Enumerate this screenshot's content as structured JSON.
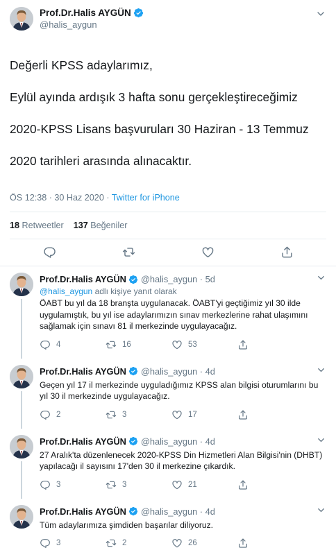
{
  "tweet": {
    "author_name": "Prof.Dr.Halis AYGÜN",
    "author_handle": "@halis_aygun",
    "lines": [
      "Değerli KPSS adaylarımız,",
      "Eylül ayında ardışık 3 hafta sonu gerçekleştireceğimiz",
      "2020-KPSS Lisans başvuruları 30 Haziran - 13 Temmuz",
      "2020 tarihleri arasında alınacaktır."
    ],
    "time": "ÖS 12:38 · 30 Haz 2020",
    "dot": " · ",
    "source": "Twitter for iPhone",
    "retweets_count": "18",
    "retweets_label": "Retweetler",
    "likes_count": "137",
    "likes_label": "Beğeniler"
  },
  "replies": [
    {
      "name": "Prof.Dr.Halis AYGÜN",
      "meta": "@halis_aygun · 5d",
      "replying_mention": "@halis_aygun",
      "replying_suffix": " adlı kişiye yanıt olarak",
      "text": "ÖABT bu yıl da 18 branşta uygulanacak. ÖABT'yi geçtiğimiz yıl 30 ilde uygulamıştık, bu yıl ise adaylarımızın sınav merkezlerine rahat ulaşımını sağlamak için sınavı 81 il merkezinde uygulayacağız.",
      "replies": "4",
      "retweets": "16",
      "likes": "53"
    },
    {
      "name": "Prof.Dr.Halis AYGÜN",
      "meta": "@halis_aygun · 4d",
      "text": "Geçen yıl 17 il merkezinde uyguladığımız KPSS alan bilgisi oturumlarını bu yıl 30 il merkezinde uygulayacağız.",
      "replies": "2",
      "retweets": "3",
      "likes": "17"
    },
    {
      "name": "Prof.Dr.Halis AYGÜN",
      "meta": "@halis_aygun · 4d",
      "text": "27 Aralık'ta düzenlenecek 2020-KPSS Din Hizmetleri Alan Bilgisi'nin (DHBT) yapılacağı il sayısını 17'den 30 il merkezine çıkardık.",
      "replies": "3",
      "retweets": "3",
      "likes": "21"
    },
    {
      "name": "Prof.Dr.Halis AYGÜN",
      "meta": "@halis_aygun · 4d",
      "text": "Tüm adaylarımıza şimdiden başarılar diliyoruz.",
      "replies": "3",
      "retweets": "2",
      "likes": "26"
    }
  ],
  "colors": {
    "link": "#1b95e0",
    "secondary_text": "#657786",
    "verified": "#1da1f2",
    "divider": "#e6ecf0"
  },
  "icons": {
    "verified": "verified-badge-icon",
    "caret": "chevron-down-icon",
    "reply": "reply-icon",
    "retweet": "retweet-icon",
    "like": "heart-icon",
    "share": "share-icon"
  }
}
